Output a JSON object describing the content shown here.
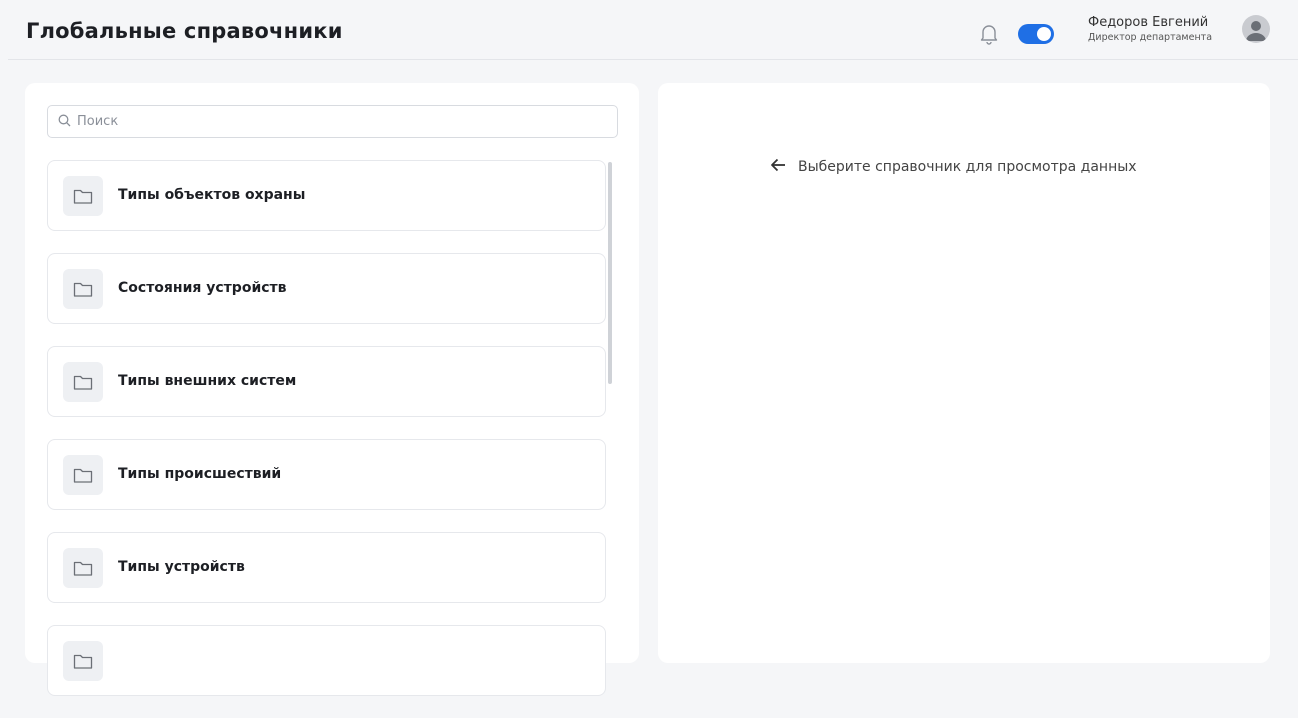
{
  "header": {
    "title": "Глобальные справочники",
    "user_name": "Федоров Евгений",
    "user_role": "Директор департамента",
    "toggle_on": true
  },
  "search": {
    "placeholder": "Поиск"
  },
  "directories": [
    {
      "label": "Типы объектов охраны"
    },
    {
      "label": "Состояния устройств"
    },
    {
      "label": "Типы внешних систем"
    },
    {
      "label": "Типы происшествий"
    },
    {
      "label": "Типы устройств"
    },
    {
      "label": ""
    }
  ],
  "detail": {
    "hint": "Выберите справочник для просмотра данных"
  },
  "colors": {
    "accent": "#1f6fe5",
    "background": "#f5f6f8",
    "panel": "#ffffff",
    "border": "#e6e8ec"
  },
  "icons": {
    "bell": "bell-icon",
    "folder": "folder-icon",
    "search": "search-icon",
    "back": "arrow-left-icon",
    "avatar": "user-avatar-icon"
  }
}
